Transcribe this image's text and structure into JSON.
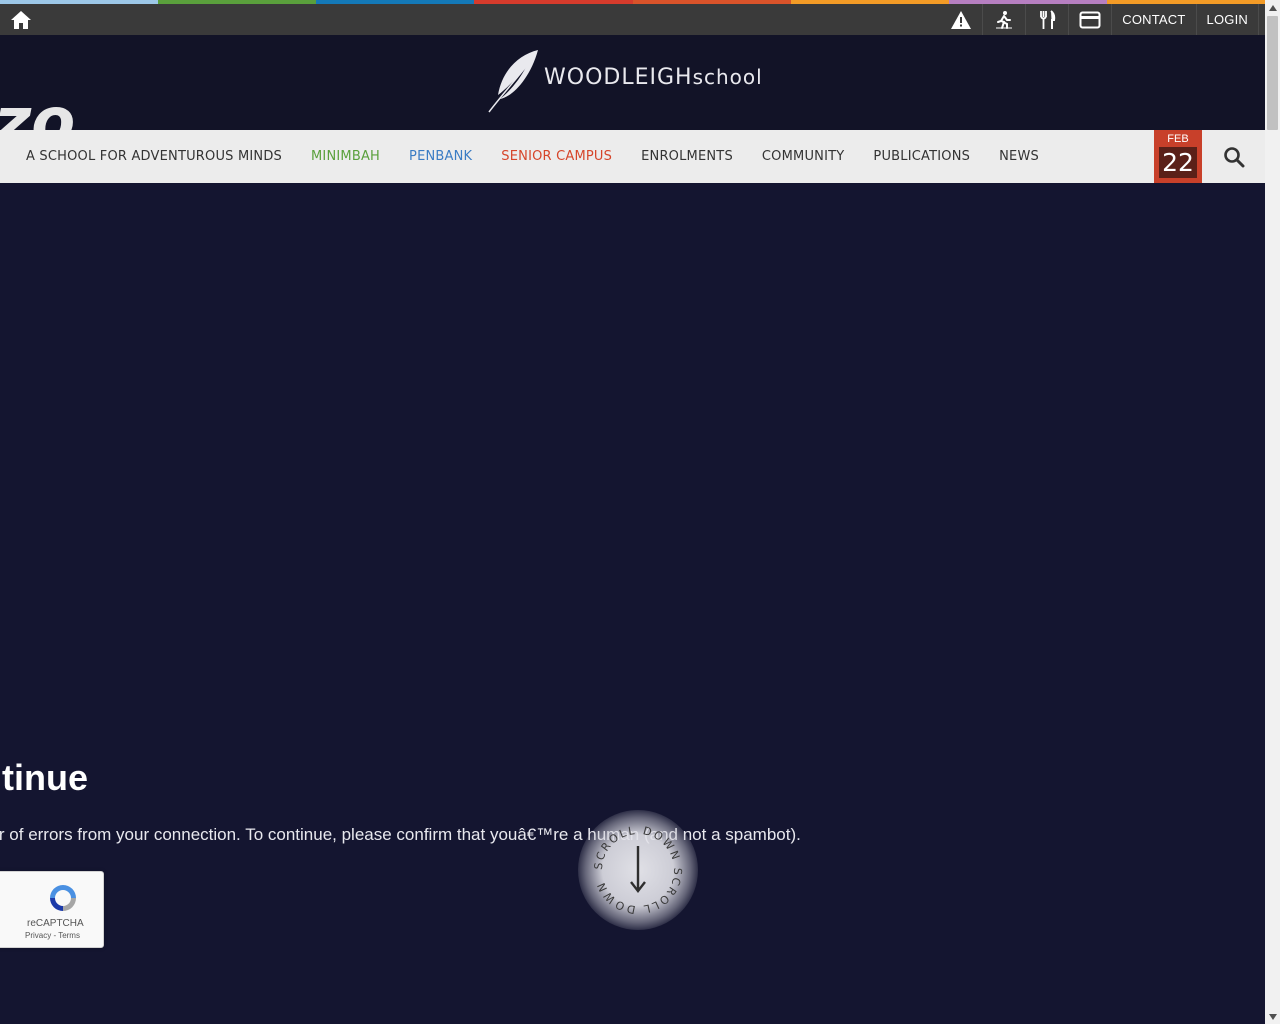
{
  "color_strip": [
    "#9dc8e8",
    "#5aa03c",
    "#1479b8",
    "#d63b2c",
    "#d9532a",
    "#f39b26",
    "#b67fc1",
    "#f39b26"
  ],
  "utility_bar": {
    "icons": [
      "warning-icon",
      "running-icon",
      "cutlery-icon",
      "card-icon"
    ],
    "contact_label": "CONTACT",
    "login_label": "LOGIN"
  },
  "header": {
    "logo_word": "WOODLEIGH",
    "logo_school": "school",
    "ghost_text": "zo"
  },
  "nav": {
    "items": [
      {
        "label": "A SCHOOL FOR ADVENTUROUS MINDS",
        "color": "#333333"
      },
      {
        "label": "MINIMBAH",
        "color": "#5aa03c"
      },
      {
        "label": "PENBANK",
        "color": "#3a7cc4"
      },
      {
        "label": "SENIOR CAMPUS",
        "color": "#d6452a"
      },
      {
        "label": "ENROLMENTS",
        "color": "#333333"
      },
      {
        "label": "COMMUNITY",
        "color": "#333333"
      },
      {
        "label": "PUBLICATIONS",
        "color": "#333333"
      },
      {
        "label": "NEWS",
        "color": "#333333"
      }
    ],
    "date": {
      "month": "FEB",
      "day": "22"
    }
  },
  "content": {
    "title": "ntinue",
    "message": "ber of errors from your connection. To continue, please confirm that youâ€™re a human (and not a spambot).",
    "recaptcha": {
      "label": "reCAPTCHA",
      "links": "Privacy - Terms"
    }
  },
  "scroll_prompt": {
    "text": "SCROLL DOWN"
  }
}
